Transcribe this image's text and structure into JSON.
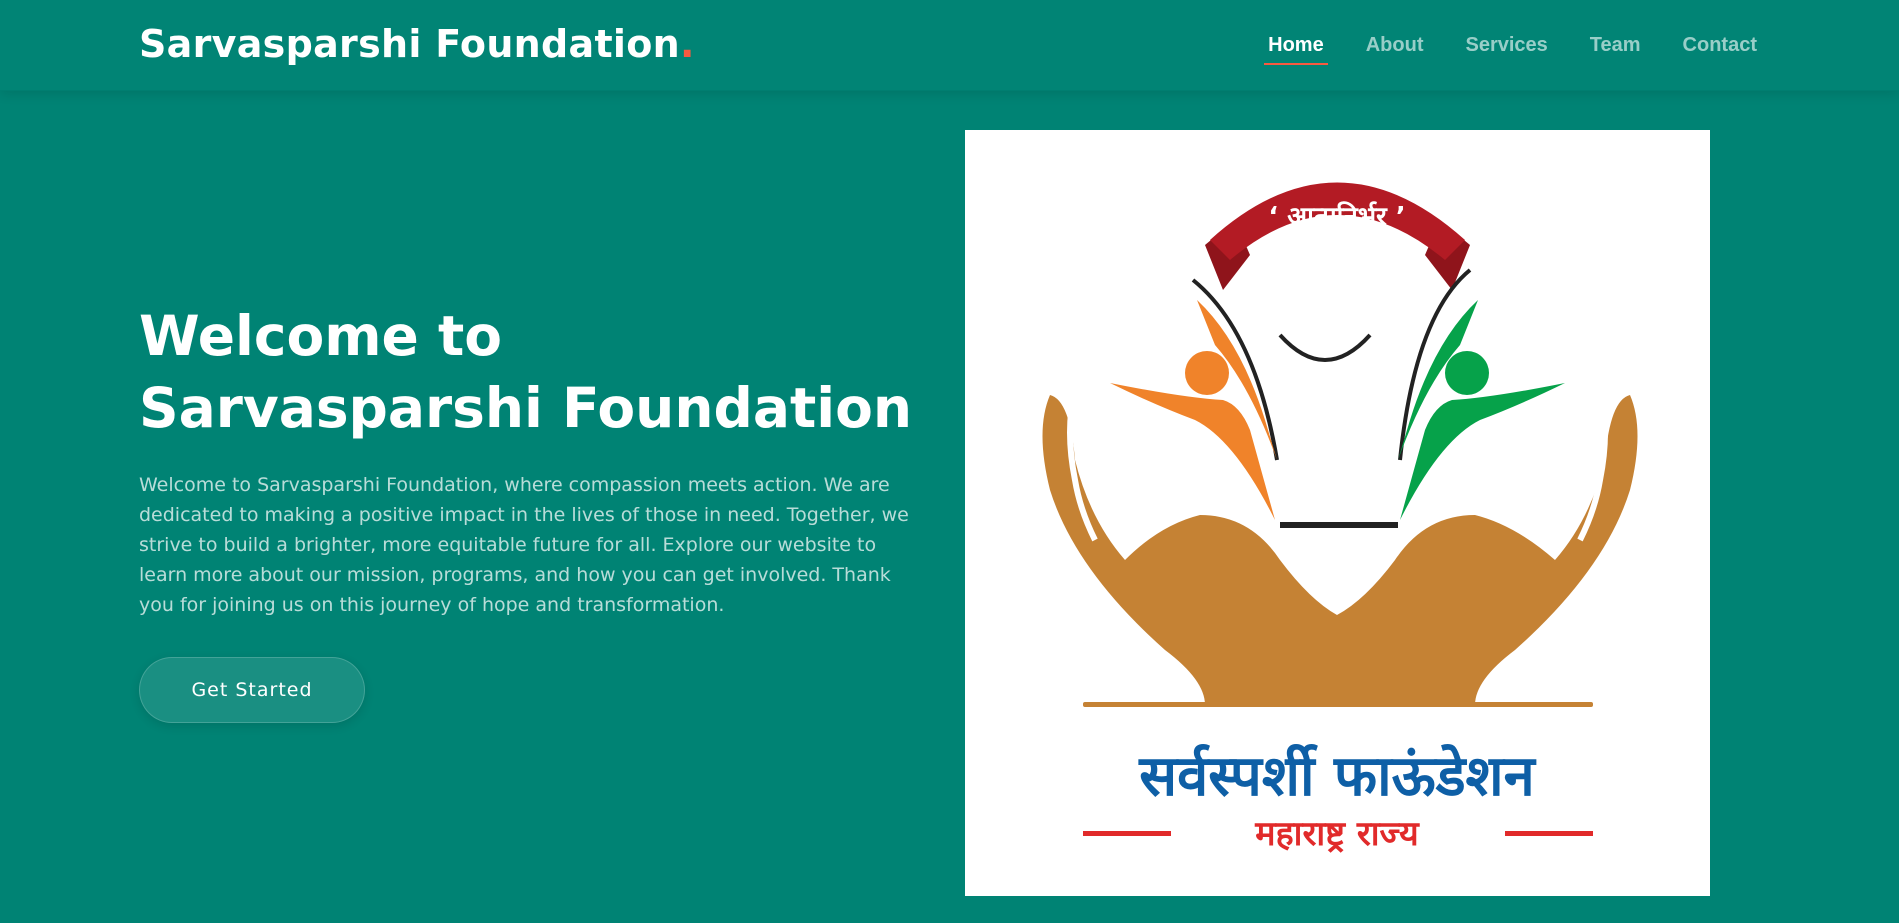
{
  "header": {
    "brand": "Sarvasparshi Foundation",
    "brand_dot": ".",
    "nav": [
      {
        "label": "Home",
        "active": true
      },
      {
        "label": "About",
        "active": false
      },
      {
        "label": "Services",
        "active": false
      },
      {
        "label": "Team",
        "active": false
      },
      {
        "label": "Contact",
        "active": false
      }
    ]
  },
  "hero": {
    "title_line1": "Welcome to",
    "title_line2": "Sarvasparshi Foundation",
    "description": "Welcome to Sarvasparshi Foundation, where compassion meets action. We are dedicated to making a positive impact in the lives of those in need. Together, we strive to build a brighter, more equitable future for all. Explore our website to learn more about our mission, programs, and how you can get involved. Thank you for joining us on this journey of hope and transformation.",
    "cta_label": "Get Started"
  },
  "logo_image": {
    "ribbon_text": "‘ आत्मनिर्भर ’",
    "name_marathi": "सर्वस्पर्शी फाऊंडेशन",
    "state_marathi": "महाराष्ट्र राज्य"
  },
  "colors": {
    "background": "#008374",
    "accent": "#f85a40",
    "ribbon": "#b31b24",
    "orange_figure": "#f0832a",
    "green_figure": "#06a24a",
    "hands": "#c58234",
    "name_blue": "#0e5fa6",
    "state_red": "#e12a2a"
  }
}
